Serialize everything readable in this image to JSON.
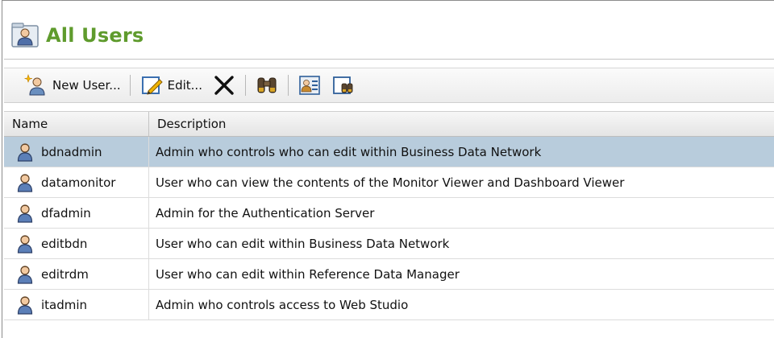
{
  "header": {
    "title": "All Users",
    "icon": "users-folder-icon"
  },
  "toolbar": {
    "new_user_label": "New User...",
    "edit_label": "Edit...",
    "delete_icon": "delete-x-icon",
    "find_icon": "binoculars-icon",
    "properties_icon": "user-properties-icon",
    "search_user_icon": "user-search-icon"
  },
  "table": {
    "columns": [
      "Name",
      "Description"
    ],
    "rows": [
      {
        "name": "bdnadmin",
        "description": "Admin who controls who can edit within Business Data Network",
        "selected": true
      },
      {
        "name": "datamonitor",
        "description": "User who can view the contents of the Monitor Viewer and Dashboard Viewer",
        "selected": false
      },
      {
        "name": "dfadmin",
        "description": "Admin for the Authentication Server",
        "selected": false
      },
      {
        "name": "editbdn",
        "description": "User who can edit within Business Data Network",
        "selected": false
      },
      {
        "name": "editrdm",
        "description": "User who can edit within Reference Data Manager",
        "selected": false
      },
      {
        "name": "itadmin",
        "description": "Admin who controls access to Web Studio",
        "selected": false
      }
    ]
  },
  "colors": {
    "title": "#5f9b2d",
    "selected_row": "#b8ccdc"
  }
}
